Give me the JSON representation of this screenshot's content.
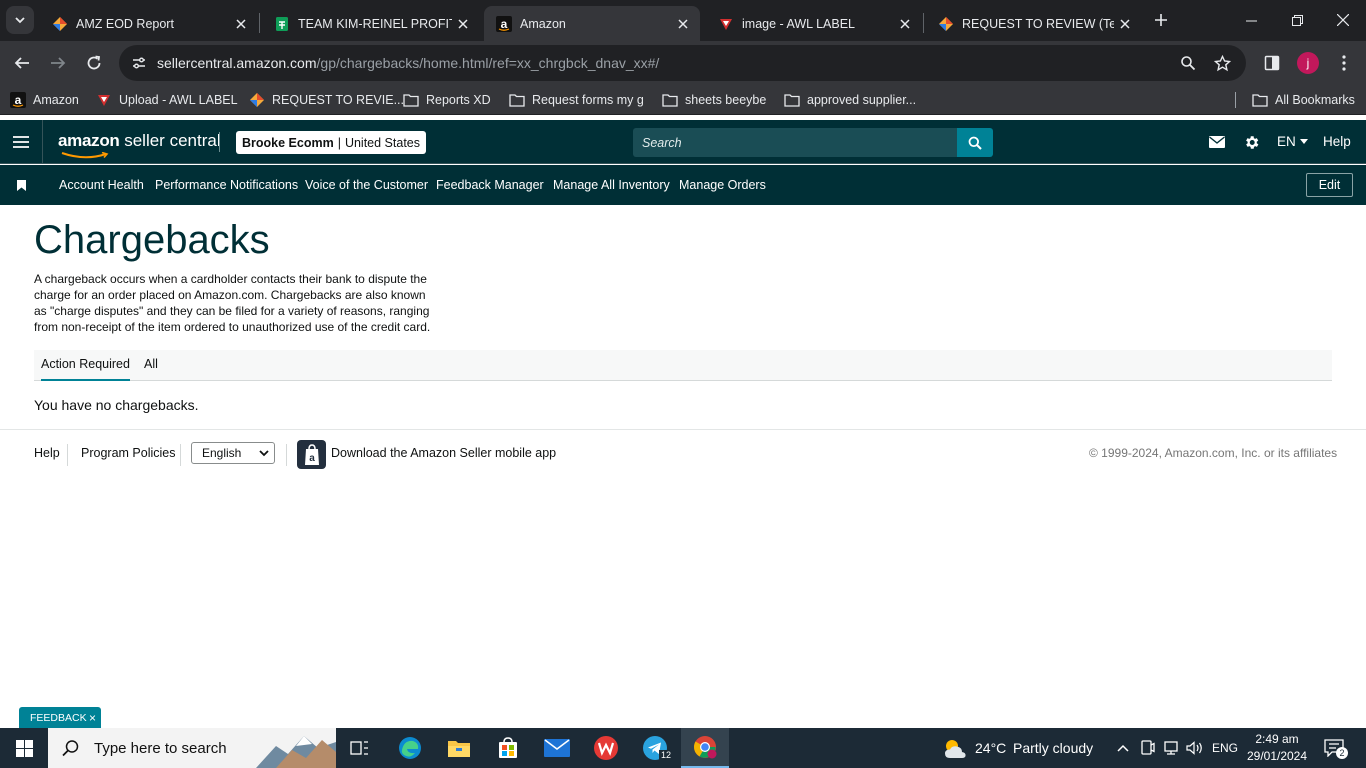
{
  "browser": {
    "tabs": [
      {
        "title": "AMZ EOD Report",
        "icon": "diamond-app-icon",
        "active": false
      },
      {
        "title": "TEAM KIM-REINEL PROFIT SHEET",
        "icon": "sheets-icon",
        "active": false
      },
      {
        "title": "Amazon",
        "icon": "amazon-icon",
        "active": true
      },
      {
        "title": "image - AWL LABEL",
        "icon": "awl-label-icon",
        "active": false
      },
      {
        "title": "REQUEST TO REVIEW (Team",
        "icon": "diamond-app-icon",
        "active": false
      }
    ],
    "url_host": "sellercentral.amazon.com",
    "url_path": "/gp/chargebacks/home.html/ref=xx_chrgbck_dnav_xx#/",
    "profile_initial": "j",
    "bookmarks": [
      {
        "label": "Amazon",
        "icon": "amazon-icon"
      },
      {
        "label": "Upload - AWL LABEL",
        "icon": "awl-label-icon"
      },
      {
        "label": "REQUEST TO REVIE...",
        "icon": "diamond-app-icon"
      },
      {
        "label": "Reports XD",
        "icon": "folder-icon"
      },
      {
        "label": "Request forms my g",
        "icon": "folder-icon"
      },
      {
        "label": "sheets beeybe",
        "icon": "folder-icon"
      },
      {
        "label": "approved supplier...",
        "icon": "folder-icon"
      }
    ],
    "all_bookmarks_label": "All Bookmarks"
  },
  "header": {
    "logo_amazon": "amazon",
    "logo_rest": " seller central",
    "account_name": "Brooke Ecomm",
    "account_region": "United States",
    "search_placeholder": "Search",
    "lang": "EN",
    "help": "Help"
  },
  "nav": {
    "items": [
      "Account Health",
      "Performance Notifications",
      "Voice of the Customer",
      "Feedback Manager",
      "Manage All Inventory",
      "Manage Orders"
    ],
    "edit_label": "Edit"
  },
  "page": {
    "title": "Chargebacks",
    "description": "A chargeback occurs when a cardholder contacts their bank to dispute the charge for an order placed on Amazon.com. Chargebacks are also known as \"charge disputes\" and they can be filed for a variety of reasons, ranging from non-receipt of the item ordered to unauthorized use of the credit card.",
    "tabs": [
      "Action Required",
      "All"
    ],
    "empty_message": "You have no chargebacks."
  },
  "footer": {
    "help": "Help",
    "program_policies": "Program Policies",
    "language": "English",
    "app_link": "Download the Amazon Seller mobile app",
    "copyright": "© 1999-2024, Amazon.com, Inc. or its affiliates"
  },
  "feedback": {
    "label": "FEEDBACK"
  },
  "taskbar": {
    "search_placeholder": "Type here to search",
    "telegram_badge": "12",
    "weather_temp": "24°C",
    "weather_desc": "Partly cloudy",
    "input_lang": "ENG",
    "time": "2:49 am",
    "date": "29/01/2024",
    "notification_count": "2"
  },
  "colors": {
    "seller_header": "#002f36",
    "accent_teal": "#008296",
    "chrome_dark": "#202124",
    "taskbar": "#1c2a36"
  }
}
